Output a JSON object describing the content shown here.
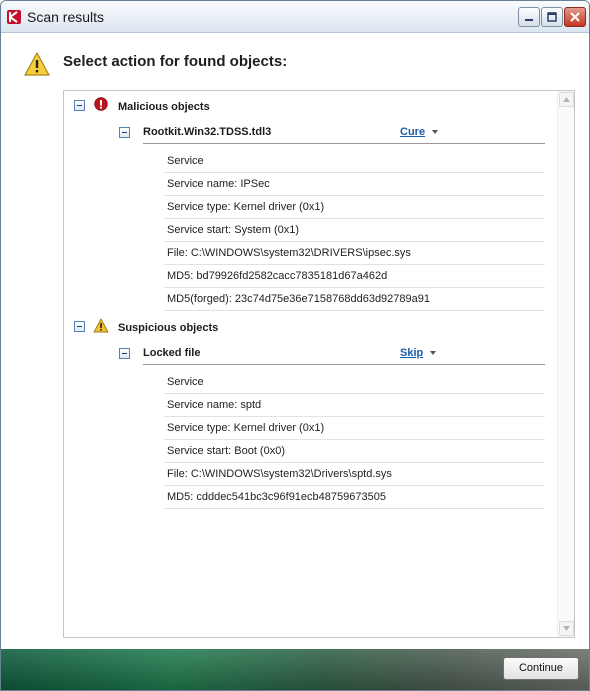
{
  "window": {
    "title": "Scan results"
  },
  "header": {
    "title": "Select action for found objects:"
  },
  "groups": [
    {
      "title": "Malicious objects",
      "threat": {
        "name": "Rootkit.Win32.TDSS.tdl3",
        "action": "Cure",
        "details": [
          "Service",
          "Service name: IPSec",
          "Service type: Kernel driver (0x1)",
          "Service start: System (0x1)",
          "File: C:\\WINDOWS\\system32\\DRIVERS\\ipsec.sys",
          "MD5: bd79926fd2582cacc7835181d67a462d",
          "MD5(forged): 23c74d75e36e7158768dd63d92789a91"
        ]
      }
    },
    {
      "title": "Suspicious objects",
      "threat": {
        "name": "Locked file",
        "action": "Skip",
        "details": [
          "Service",
          "Service name: sptd",
          "Service type: Kernel driver (0x1)",
          "Service start: Boot (0x0)",
          "File: C:\\WINDOWS\\system32\\Drivers\\sptd.sys",
          "MD5: cdddec541bc3c96f91ecb48759673505"
        ]
      }
    }
  ],
  "footer": {
    "continue_label": "Continue"
  },
  "colors": {
    "link": "#1a5dab",
    "malicious": "#c0141c",
    "suspicious": "#f2c230",
    "footer_green": "#1f7a4d"
  }
}
